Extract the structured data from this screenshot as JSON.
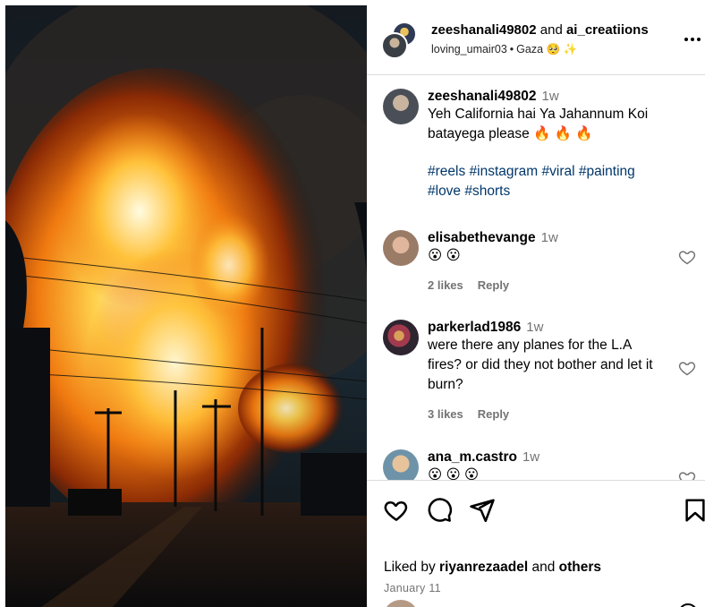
{
  "post": {
    "owner_primary": "zeeshanali49802",
    "owner_conjunction": "and",
    "owner_secondary": "ai_creatiions",
    "audio_user": "loving_umair03",
    "separator": "•",
    "location": "Gaza 🥺 ✨",
    "more_icon": "more-horizontal-icon"
  },
  "caption": {
    "username": "zeeshanali49802",
    "time": "1w",
    "text": "Yeh California hai Ya Jahannum Koi batayega please 🔥 🔥 🔥",
    "hashtags_line1": "#reels #instagram #viral #painting",
    "hashtags_line2": "#love #shorts"
  },
  "comments": [
    {
      "username": "elisabethevange",
      "time": "1w",
      "text": "😮 😮",
      "likes": "2 likes",
      "reply": "Reply"
    },
    {
      "username": "parkerlad1986",
      "time": "1w",
      "text": "were there any planes for the L.A fires? or did they not bother and let it burn?",
      "likes": "3 likes",
      "reply": "Reply"
    },
    {
      "username": "ana_m.castro",
      "time": "1w",
      "text": "😮 😮 😮"
    }
  ],
  "actions": {
    "like_icon": "heart-icon",
    "comment_icon": "comment-icon",
    "share_icon": "send-icon",
    "save_icon": "bookmark-icon"
  },
  "likes_summary": {
    "prefix": "Liked by",
    "user": "riyanrezaadel",
    "conjunction": "and",
    "others": "others"
  },
  "date": "January 11",
  "colors": {
    "hashtag": "#00376b",
    "muted": "#737373",
    "border": "#dbdbdb"
  }
}
